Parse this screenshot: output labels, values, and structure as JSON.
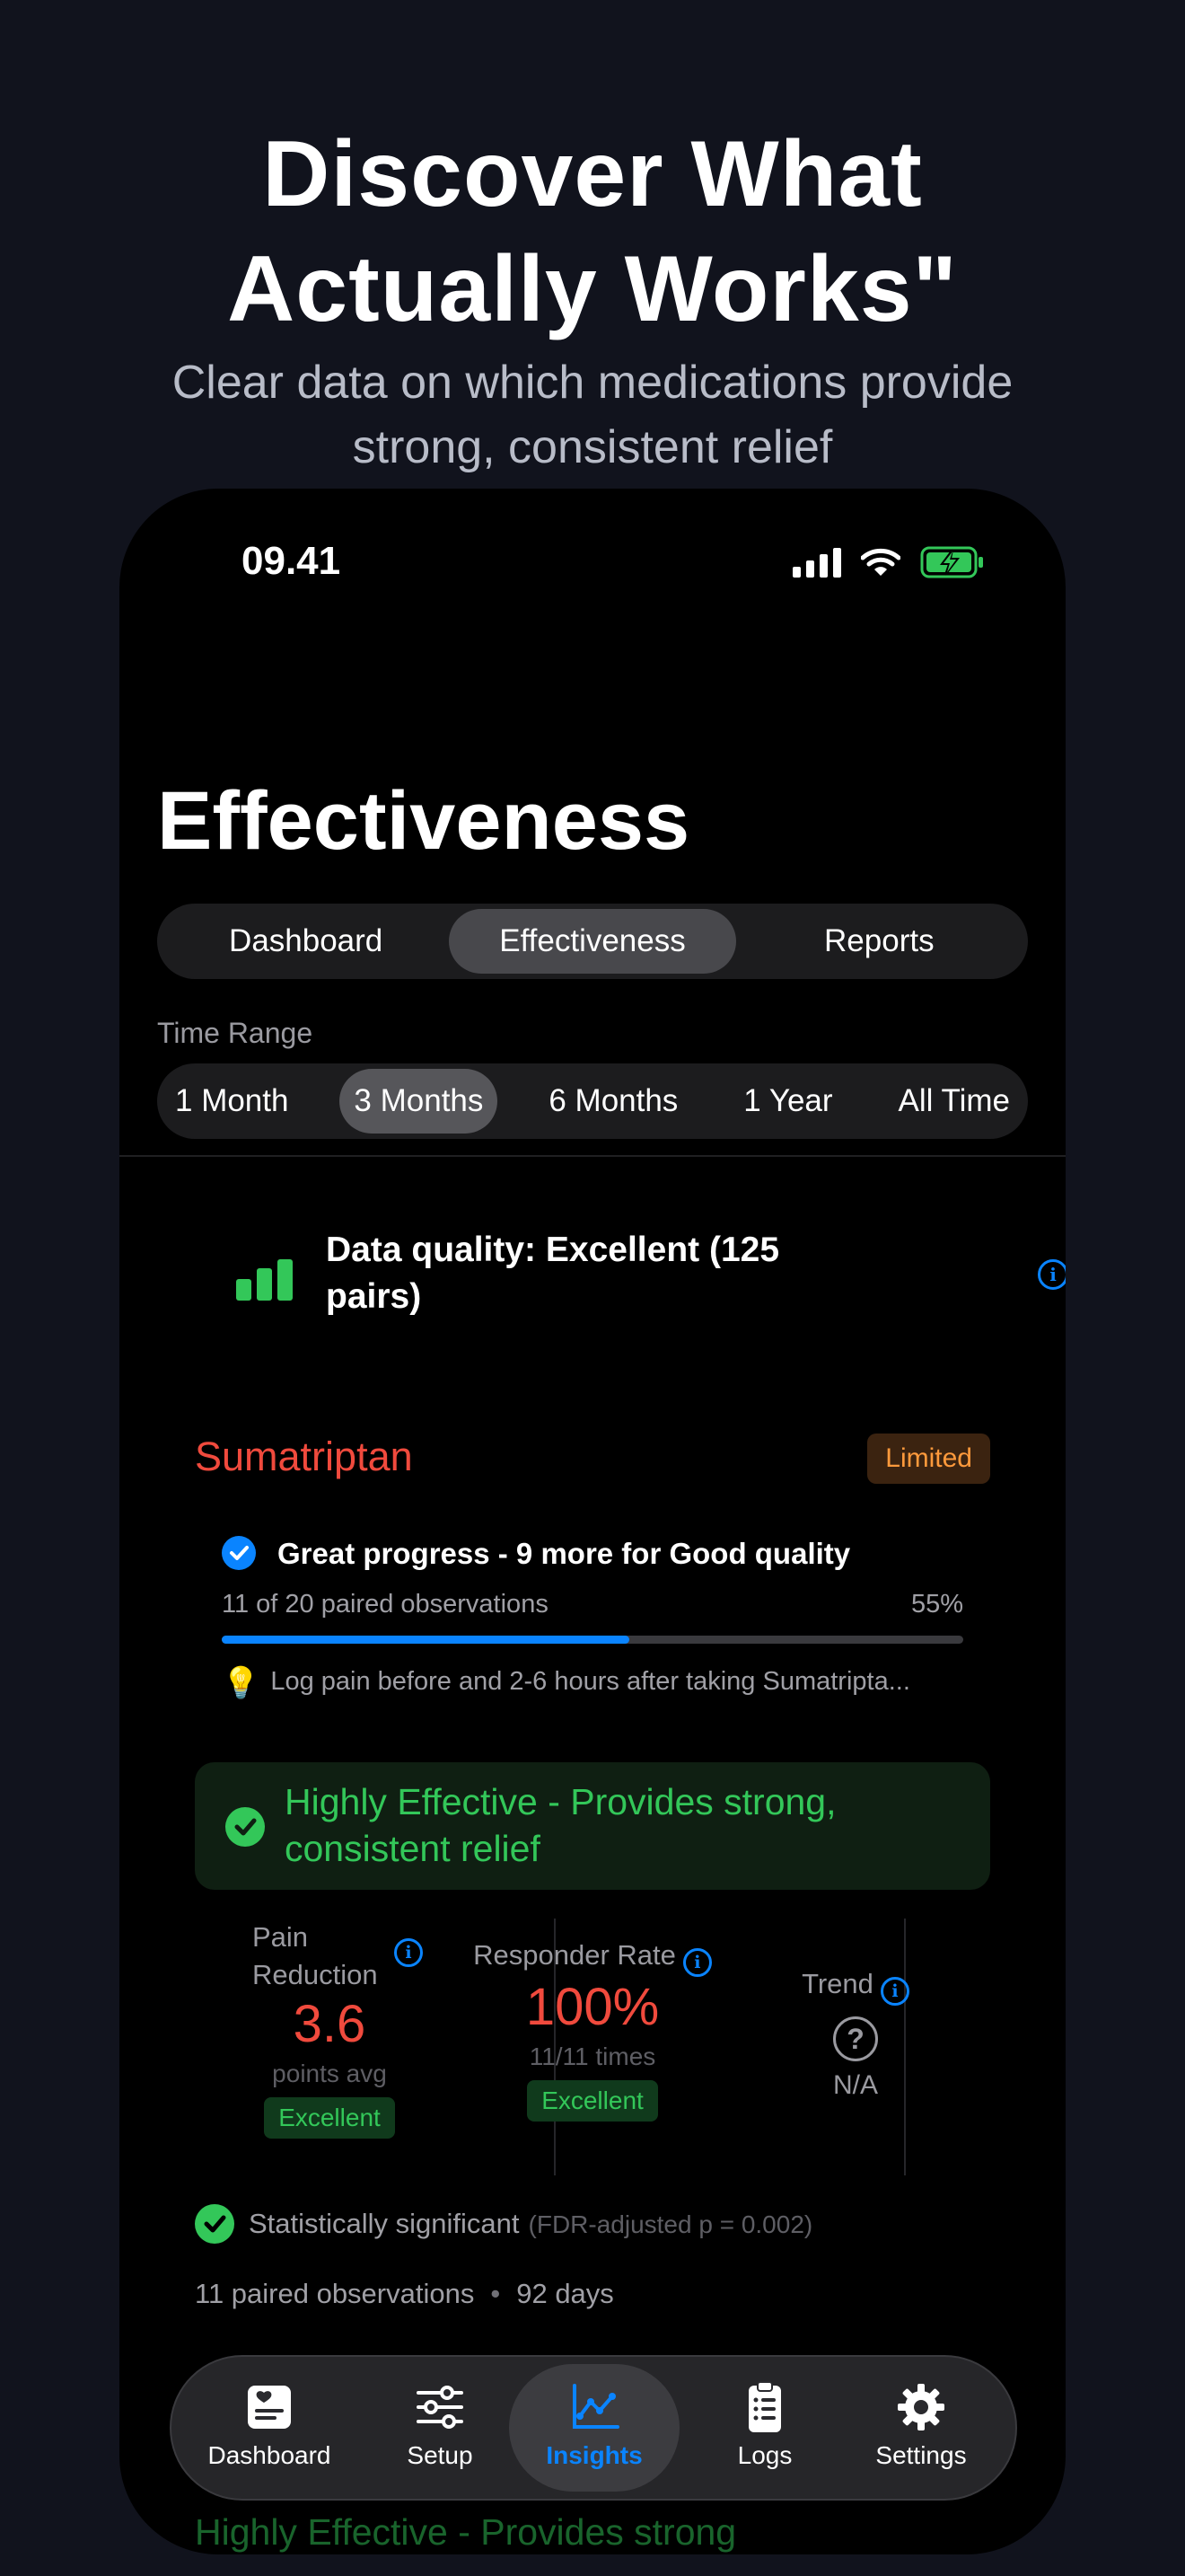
{
  "promo": {
    "headline_line1": "Discover What",
    "headline_line2": "Actually Works\"",
    "subline": "Clear data on which medications provide strong, consistent relief"
  },
  "status_bar": {
    "time": "09.41"
  },
  "page": {
    "title": "Effectiveness"
  },
  "main_tabs": [
    {
      "label": "Dashboard",
      "active": false
    },
    {
      "label": "Effectiveness",
      "active": true
    },
    {
      "label": "Reports",
      "active": false
    }
  ],
  "time_range": {
    "label": "Time Range",
    "options": [
      "1 Month",
      "3 Months",
      "6 Months",
      "1 Year",
      "All Time"
    ],
    "selected": "3 Months"
  },
  "data_quality": {
    "text": "Data quality: Excellent (125 pairs)"
  },
  "medication": {
    "name": "Sumatriptan",
    "badge": "Limited",
    "progress": {
      "title": "Great progress - 9 more for Good quality",
      "subtitle": "11 of 20 paired observations",
      "percent_label": "55%",
      "fraction": 0.55,
      "tip": "Log pain before and 2-6 hours after taking Sumatripta..."
    },
    "verdict": "Highly Effective - Provides strong, consistent relief",
    "metrics": {
      "pain_reduction": {
        "label": "Pain Reduction",
        "value": "3.6",
        "unit": "points avg",
        "rating": "Excellent"
      },
      "responder_rate": {
        "label": "Responder Rate",
        "value": "100%",
        "unit": "11/11 times",
        "rating": "Excellent"
      },
      "trend": {
        "label": "Trend",
        "value": "N/A"
      }
    },
    "significance": {
      "text": "Statistically significant",
      "note": "(FDR-adjusted p = 0.002)"
    },
    "observations": "11 paired observations",
    "days": "92 days"
  },
  "next_card_preview": "Highly Effective - Provides strong",
  "tab_bar": [
    {
      "label": "Dashboard",
      "icon": "heart-card-icon",
      "active": false
    },
    {
      "label": "Setup",
      "icon": "sliders-icon",
      "active": false
    },
    {
      "label": "Insights",
      "icon": "line-chart-icon",
      "active": true
    },
    {
      "label": "Logs",
      "icon": "clipboard-list-icon",
      "active": false
    },
    {
      "label": "Settings",
      "icon": "gear-icon",
      "active": false
    }
  ],
  "colors": {
    "accent_blue": "#0a84ff",
    "success_green": "#33c759",
    "danger_red": "#f04a3d",
    "warning_orange": "#ff9a3c"
  }
}
